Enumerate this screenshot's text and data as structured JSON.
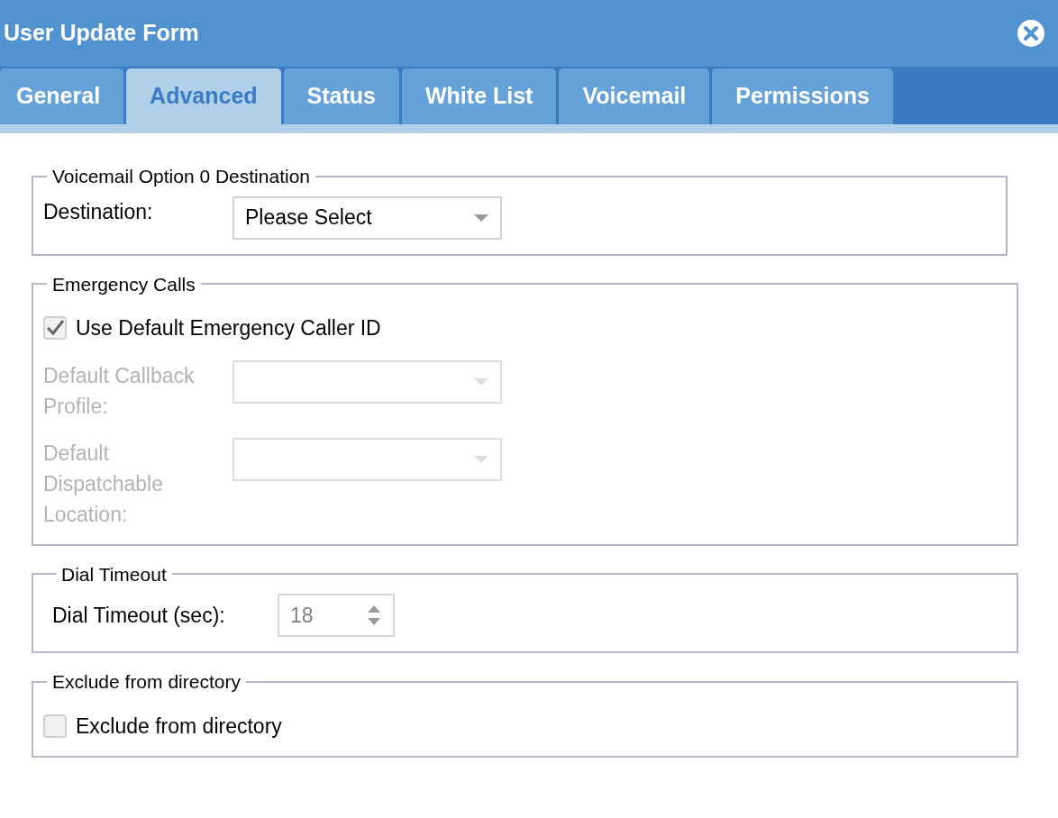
{
  "window": {
    "title": "User Update Form"
  },
  "tabs": [
    {
      "label": "General",
      "selected": false
    },
    {
      "label": "Advanced",
      "selected": true
    },
    {
      "label": "Status",
      "selected": false
    },
    {
      "label": "White List",
      "selected": false
    },
    {
      "label": "Voicemail",
      "selected": false
    },
    {
      "label": "Permissions",
      "selected": false
    }
  ],
  "sections": [
    {
      "legend": "Voicemail Option 0 Destination",
      "rows": [
        {
          "kind": "select",
          "label": "Destination:",
          "value": "Please Select",
          "disabled": false
        }
      ]
    },
    {
      "legend": "Emergency Calls",
      "rows": [
        {
          "kind": "checkbox",
          "label": "Use Default Emergency Caller ID",
          "checked": true
        },
        {
          "kind": "select",
          "label": "Default Callback Profile:",
          "disabled": true
        },
        {
          "kind": "select",
          "label": "Default Dispatchable Location:",
          "disabled": true
        }
      ]
    },
    {
      "legend": "Dial Timeout",
      "rows": [
        {
          "kind": "number",
          "label": "Dial Timeout (sec):",
          "value": "18"
        }
      ]
    },
    {
      "legend": "Exclude from directory",
      "rows": [
        {
          "kind": "checkbox",
          "label": "Exclude from directory",
          "checked": false
        }
      ]
    }
  ]
}
